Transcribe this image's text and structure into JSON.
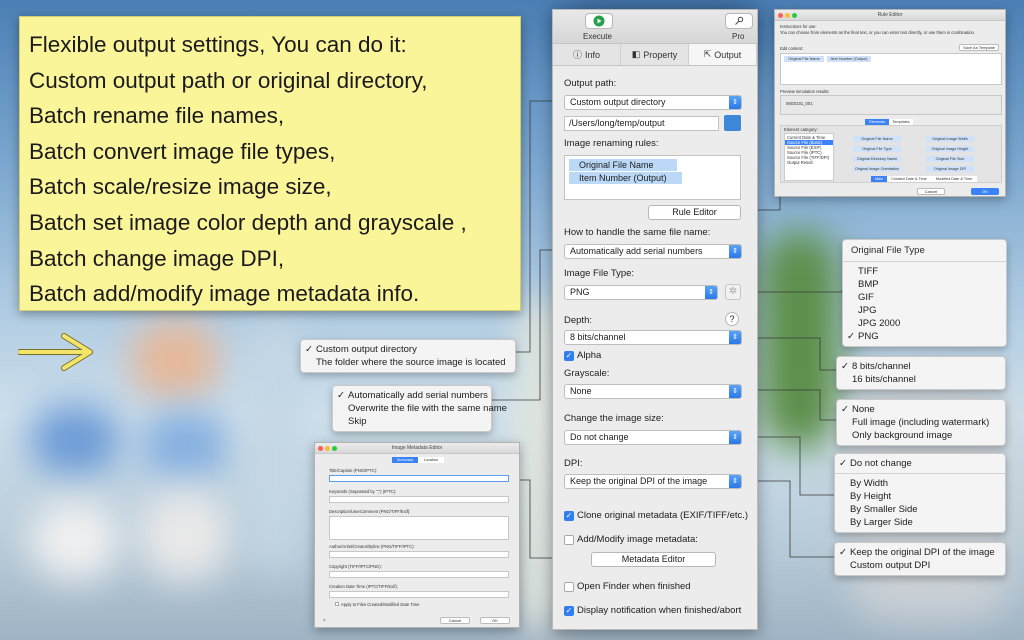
{
  "note": {
    "lines": [
      "Flexible output settings, You can do it:",
      "Custom output path or original directory,",
      "Batch rename file names,",
      "Batch convert image file types,",
      "Batch scale/resize image size,",
      "Batch set image color depth and grayscale ,",
      "Batch change image DPI,",
      "Batch add/modify image metadata info."
    ]
  },
  "panel": {
    "toolbar": {
      "execute_label": "Execute",
      "pro_label": "Pro"
    },
    "tabs": [
      {
        "label": "Info"
      },
      {
        "label": "Property"
      },
      {
        "label": "Output"
      }
    ],
    "output_path_label": "Output path:",
    "output_path_value": "Custom output directory",
    "output_path_text": "/Users/long/temp/output",
    "renaming_label": "Image renaming rules:",
    "rename_tokens": [
      "Original File Name",
      "Item Number (Output)"
    ],
    "rule_editor_button": "Rule Editor",
    "same_name_label": "How to handle the same file name:",
    "same_name_value": "Automatically add serial numbers",
    "file_type_label": "Image File Type:",
    "file_type_value": "PNG",
    "depth_label": "Depth:",
    "depth_value": "8 bits/channel",
    "help": "?",
    "alpha_label": "Alpha",
    "grayscale_label": "Grayscale:",
    "grayscale_value": "None",
    "resize_label": "Change the image size:",
    "resize_value": "Do not change",
    "dpi_label": "DPI:",
    "dpi_value": "Keep the original DPI of the image",
    "clone_label": "Clone original metadata (EXIF/TIFF/etc.)",
    "addmod_label": "Add/Modify image metadata:",
    "metadata_editor_button": "Metadata Editor",
    "open_finder_label": "Open Finder when finished",
    "notify_label": "Display notification when finished/abort"
  },
  "menus": {
    "output_dir": {
      "items": [
        "Custom output directory",
        "The folder where the source image is located"
      ],
      "checked": 0
    },
    "same_name": {
      "items": [
        "Automatically add serial numbers",
        "Overwrite the file with the same name",
        "Skip"
      ],
      "checked": 0
    },
    "file_type": {
      "header": "Original File Type",
      "items": [
        "TIFF",
        "BMP",
        "GIF",
        "JPG",
        "JPG 2000",
        "PNG"
      ],
      "checked": 5
    },
    "depth": {
      "items": [
        "8 bits/channel",
        "16 bits/channel"
      ],
      "checked": 0
    },
    "grayscale": {
      "items": [
        "None",
        "Full image (including watermark)",
        "Only background image"
      ],
      "checked": 0
    },
    "resize": {
      "items": [
        "Do not change",
        "By Width",
        "By Height",
        "By Smaller Side",
        "By Larger Side"
      ],
      "checked": 0
    },
    "dpi": {
      "items": [
        "Keep the original DPI of the image",
        "Custom output DPI"
      ],
      "checked": 0
    }
  },
  "rule_editor": {
    "title": "Rule Editor",
    "instructions_title": "Instructions for use:",
    "instructions": "You can choose from elements as the final text, or you can enter text directly, or use them in combination.",
    "edit_content": "Edit content:",
    "save_default": "Save As Template",
    "tokens": [
      "Original File Name",
      "Item Number (Output)"
    ],
    "preview_label": "Preview simulation results:",
    "preview_value": "IMG0101_001",
    "seg_tabs": [
      "Elements",
      "Templates"
    ],
    "element_category": "Element category:",
    "categories": [
      "Current Date & Time",
      "Source File (Basic)",
      "Source File (EXIF)",
      "Source File (IPTC)",
      "Source File (TIFF/DPI)",
      "Output Result"
    ],
    "elements": [
      "Original File Name",
      "Original Image Width",
      "Original File Type",
      "Original Image Height",
      "Original Directory Name",
      "Original File Size",
      "Original Image Orientation",
      "Original Image DPI"
    ],
    "bottom_tabs": [
      "Main",
      "Created Date & Time",
      "Modified Date & Time"
    ],
    "cancel": "Cancel",
    "ok": "OK"
  },
  "metadata_editor": {
    "title": "Image Metadata Editor",
    "tabs": [
      "Summary",
      "Location"
    ],
    "fields": [
      "Title/Caption (PNG/IPTC):",
      "Keywords (Separated by \";\") (IPTC):",
      "Description/UserComment (PNG/TIFF/Exif):",
      "Author/Artist/Creator/Byline (PNG/TIFF/IPTC):",
      "Copyright (TIFF/IPTC/PNG):",
      "Creation Date Time (IPTC/TIFF/Exif):"
    ],
    "apply_label": "Apply to Files Created/Modified Date Time",
    "help": "?",
    "cancel": "Cancel",
    "ok": "OK"
  },
  "colors": {
    "note_bg": "#fbf59a",
    "accent": "#2f7ff0",
    "arrow": "#f2e66a"
  }
}
